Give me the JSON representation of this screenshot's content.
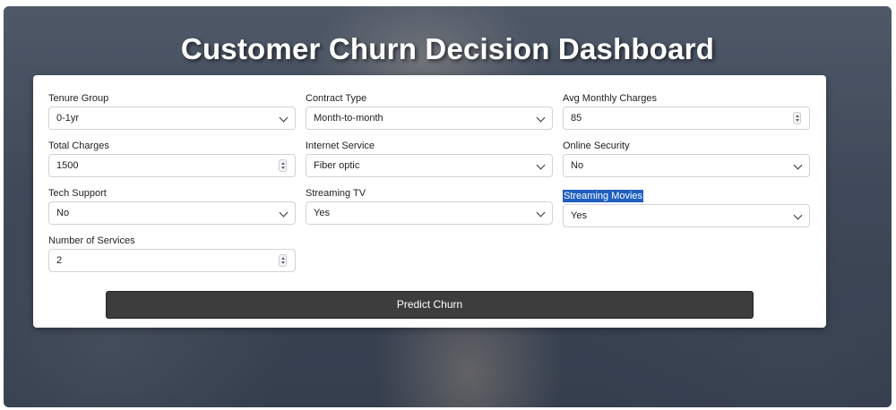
{
  "title": "Customer Churn Decision Dashboard",
  "form": {
    "tenure_group": {
      "label": "Tenure Group",
      "value": "0-1yr"
    },
    "contract_type": {
      "label": "Contract Type",
      "value": "Month-to-month"
    },
    "avg_monthly_charges": {
      "label": "Avg Monthly Charges",
      "value": "85"
    },
    "total_charges": {
      "label": "Total Charges",
      "value": "1500"
    },
    "internet_service": {
      "label": "Internet Service",
      "value": "Fiber optic"
    },
    "online_security": {
      "label": "Online Security",
      "value": "No"
    },
    "tech_support": {
      "label": "Tech Support",
      "value": "No"
    },
    "streaming_tv": {
      "label": "Streaming TV",
      "value": "Yes"
    },
    "streaming_movies": {
      "label": "Streaming Movies",
      "value": "Yes"
    },
    "number_of_services": {
      "label": "Number of Services",
      "value": "2"
    }
  },
  "predict_button": "Predict Churn",
  "icons": {
    "select": "chevron-down-icon",
    "number": "spinner-icon"
  },
  "colors": {
    "button_bg": "#3d3d3d",
    "selection_highlight": "#1f5fbf"
  }
}
